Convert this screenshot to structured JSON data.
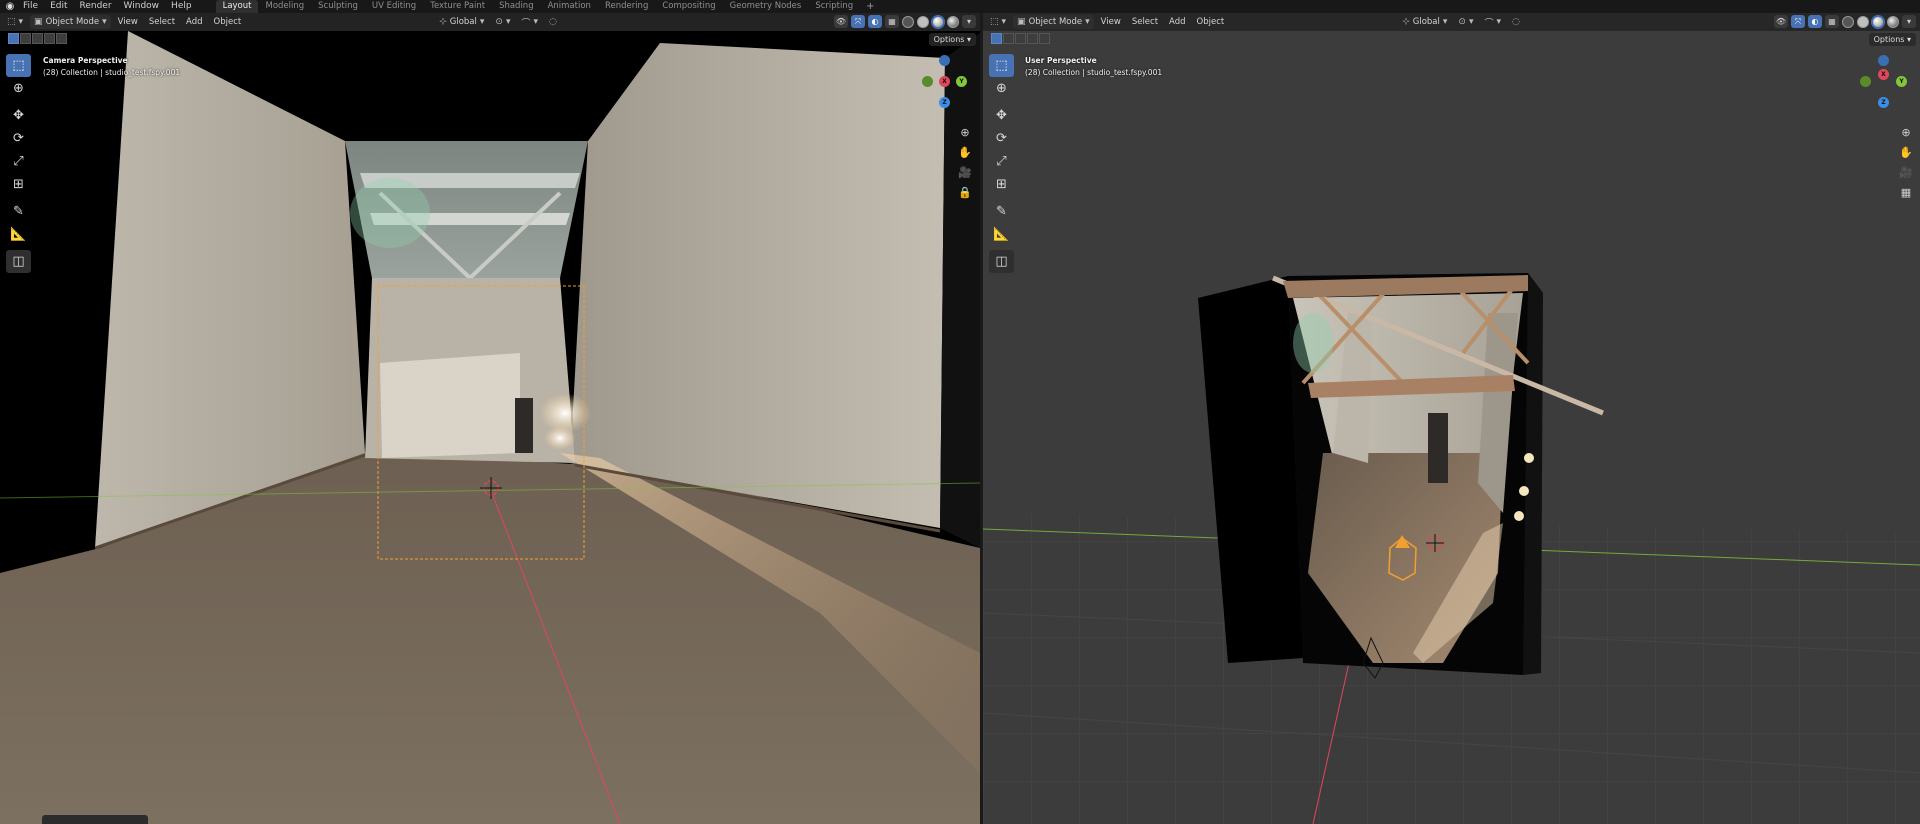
{
  "topbar": {
    "menus": [
      "File",
      "Edit",
      "Render",
      "Window",
      "Help"
    ],
    "workspaces": [
      "Layout",
      "Modeling",
      "Sculpting",
      "UV Editing",
      "Texture Paint",
      "Shading",
      "Animation",
      "Rendering",
      "Compositing",
      "Geometry Nodes",
      "Scripting"
    ],
    "active_workspace": "Layout",
    "add_tab": "+"
  },
  "viewports": {
    "left": {
      "mode": "Object Mode",
      "menus": [
        "View",
        "Select",
        "Add",
        "Object"
      ],
      "orientation": "Global",
      "options": "Options",
      "info_title": "Camera Perspective",
      "info_collection": "(28) Collection | studio_test.fspy.001"
    },
    "right": {
      "mode": "Object Mode",
      "menus": [
        "View",
        "Select",
        "Add",
        "Object"
      ],
      "orientation": "Global",
      "options": "Options",
      "info_title": "User Perspective",
      "info_collection": "(28) Collection | studio_test.fspy.001"
    }
  },
  "gizmo_axes": {
    "x": "X",
    "y": "Y",
    "z": "Z"
  },
  "colors": {
    "accent": "#4772b3",
    "axis_x": "#e0475c",
    "axis_y": "#83c53b",
    "axis_z": "#3a8ee6",
    "selection": "#f0a030"
  }
}
